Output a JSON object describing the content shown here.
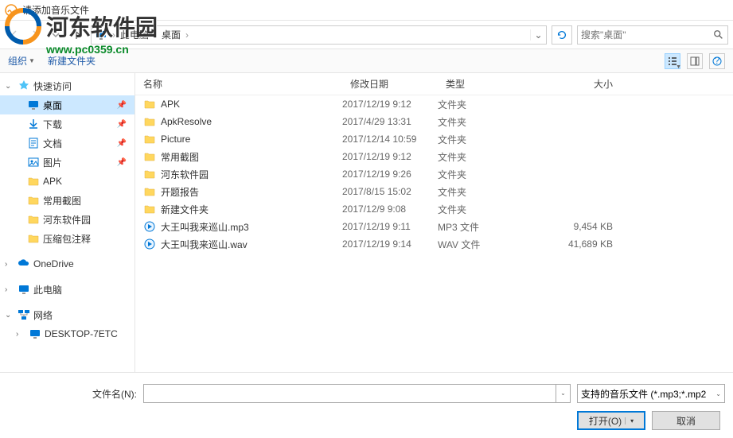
{
  "title": "请添加音乐文件",
  "watermark": {
    "text": "河东软件园",
    "url": "www.pc0359.cn"
  },
  "nav": {
    "breadcrumb": [
      "此电脑",
      "桌面"
    ],
    "search_placeholder": "搜索\"桌面\""
  },
  "toolbar": {
    "organize": "组织",
    "newfolder": "新建文件夹"
  },
  "sidebar": {
    "quick": "快速访问",
    "items": [
      {
        "label": "桌面",
        "icon": "desktop",
        "pin": true,
        "selected": true
      },
      {
        "label": "下载",
        "icon": "download",
        "pin": true
      },
      {
        "label": "文档",
        "icon": "doc",
        "pin": true
      },
      {
        "label": "图片",
        "icon": "pic",
        "pin": true
      },
      {
        "label": "APK",
        "icon": "folder"
      },
      {
        "label": "常用截图",
        "icon": "folder"
      },
      {
        "label": "河东软件园",
        "icon": "folder"
      },
      {
        "label": "压缩包注释",
        "icon": "folder"
      }
    ],
    "onedrive": "OneDrive",
    "thispc": "此电脑",
    "network": "网络",
    "networkpc": "DESKTOP-7ETC"
  },
  "columns": {
    "name": "名称",
    "date": "修改日期",
    "type": "类型",
    "size": "大小"
  },
  "rows": [
    {
      "name": "APK",
      "date": "2017/12/19 9:12",
      "type": "文件夹",
      "size": "",
      "icon": "folder"
    },
    {
      "name": "ApkResolve",
      "date": "2017/4/29 13:31",
      "type": "文件夹",
      "size": "",
      "icon": "folder"
    },
    {
      "name": "Picture",
      "date": "2017/12/14 10:59",
      "type": "文件夹",
      "size": "",
      "icon": "folder"
    },
    {
      "name": "常用截图",
      "date": "2017/12/19 9:12",
      "type": "文件夹",
      "size": "",
      "icon": "folder"
    },
    {
      "name": "河东软件园",
      "date": "2017/12/19 9:26",
      "type": "文件夹",
      "size": "",
      "icon": "folder"
    },
    {
      "name": "开题报告",
      "date": "2017/8/15 15:02",
      "type": "文件夹",
      "size": "",
      "icon": "folder"
    },
    {
      "name": "新建文件夹",
      "date": "2017/12/9 9:08",
      "type": "文件夹",
      "size": "",
      "icon": "folder"
    },
    {
      "name": "大王叫我来巡山.mp3",
      "date": "2017/12/19 9:11",
      "type": "MP3 文件",
      "size": "9,454 KB",
      "icon": "audio"
    },
    {
      "name": "大王叫我来巡山.wav",
      "date": "2017/12/19 9:14",
      "type": "WAV 文件",
      "size": "41,689 KB",
      "icon": "audio"
    }
  ],
  "bottom": {
    "filename_label": "文件名(N):",
    "filter": "支持的音乐文件 (*.mp3;*.mp2",
    "open": "打开(O)",
    "cancel": "取消"
  }
}
